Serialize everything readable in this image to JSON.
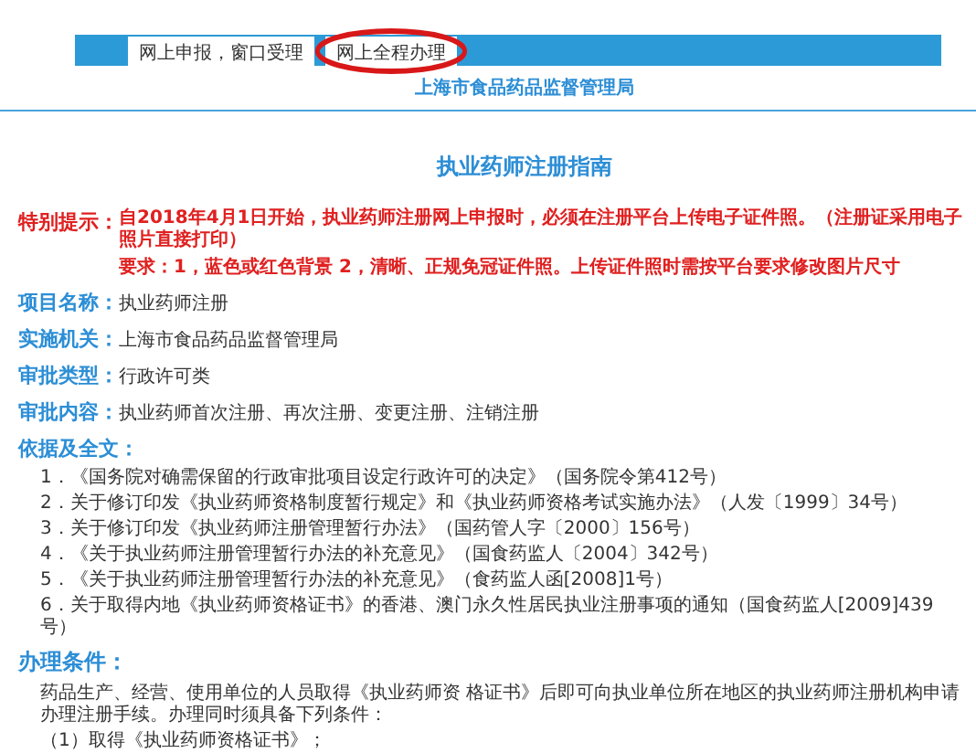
{
  "nav_buttons": [
    {
      "label": "网上申报，窗口受理",
      "circled": false
    },
    {
      "label": "网上全程办理",
      "circled": true
    }
  ],
  "agency": "上海市食品药品监督管理局",
  "title": "执业药师注册指南",
  "notice": {
    "label": "特别提示：",
    "lines": [
      "自2018年4月1日开始，执业药师注册网上申报时，必须在注册平台上传电子证件照。（注册证采用电子照片直接打印）",
      "要求：1，蓝色或红色背景  2，清晰、正规免冠证件照。上传证件照时需按平台要求修改图片尺寸"
    ]
  },
  "fields": [
    {
      "label": "项目名称：",
      "value": "执业药师注册"
    },
    {
      "label": "实施机关：",
      "value": "上海市食品药品监督管理局"
    },
    {
      "label": "审批类型：",
      "value": "行政许可类"
    },
    {
      "label": "审批内容：",
      "value": "执业药师首次注册、再次注册、变更注册、注销注册"
    },
    {
      "label": "依据及全文："
    }
  ],
  "references": [
    "1．《国务院对确需保留的行政审批项目设定行政许可的决定》（国务院令第412号）",
    "2．关于修订印发《执业药师资格制度暂行规定》和《执业药师资格考试实施办法》（人发〔1999〕34号）",
    "3．关于修订印发《执业药师注册管理暂行办法》（国药管人字〔2000〕156号）",
    "4．《关于执业药师注册管理暂行办法的补充意见》（国食药监人〔2004〕342号）",
    "5．《关于执业药师注册管理暂行办法的补充意见》（食药监人函[2008]1号）",
    "6．关于取得内地《执业药师资格证书》的香港、澳门永久性居民执业注册事项的通知（国食药监人[2009]439号）"
  ],
  "conditions": {
    "heading": "办理条件：",
    "intro": "药品生产、经营、使用单位的人员取得《执业药师资 格证书》后即可向执业单位所在地区的执业药师注册机构申请办理注册手续。办理同时须具备下列条件：",
    "items": [
      "（1）取得《执业药师资格证书》；"
    ]
  }
}
